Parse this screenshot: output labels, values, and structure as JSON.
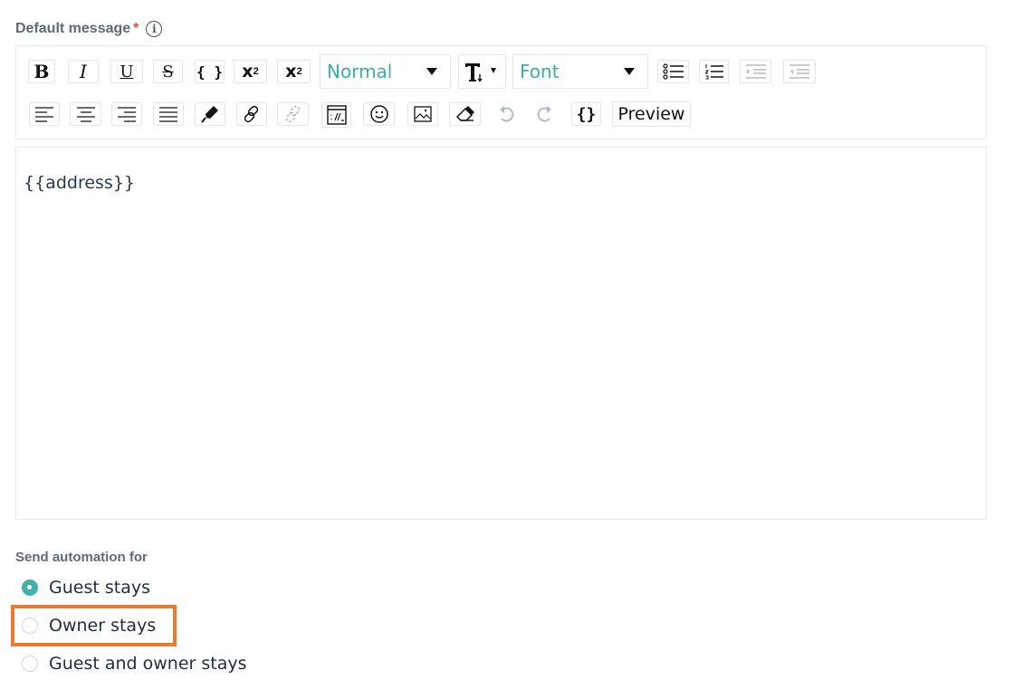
{
  "field": {
    "label": "Default message",
    "required_mark": "*",
    "info_glyph": "i"
  },
  "toolbar": {
    "bold": "B",
    "italic": "I",
    "underline": "U",
    "strike": "S",
    "code": "{ }",
    "superscript": "x",
    "superscript_mark": "2",
    "subscript": "x",
    "subscript_mark": "2",
    "paragraph_select": "Normal",
    "font_select": "Font",
    "preview_label": "Preview",
    "variable_label": "{}"
  },
  "editor": {
    "content": "{{address}}"
  },
  "automation": {
    "label": "Send automation for",
    "options": [
      {
        "label": "Guest stays",
        "checked": true
      },
      {
        "label": "Owner stays",
        "checked": false
      },
      {
        "label": "Guest and owner stays",
        "checked": false
      }
    ]
  },
  "colors": {
    "accent": "#43b1ab",
    "highlight": "#ec7a2c",
    "required": "#e0502a"
  }
}
